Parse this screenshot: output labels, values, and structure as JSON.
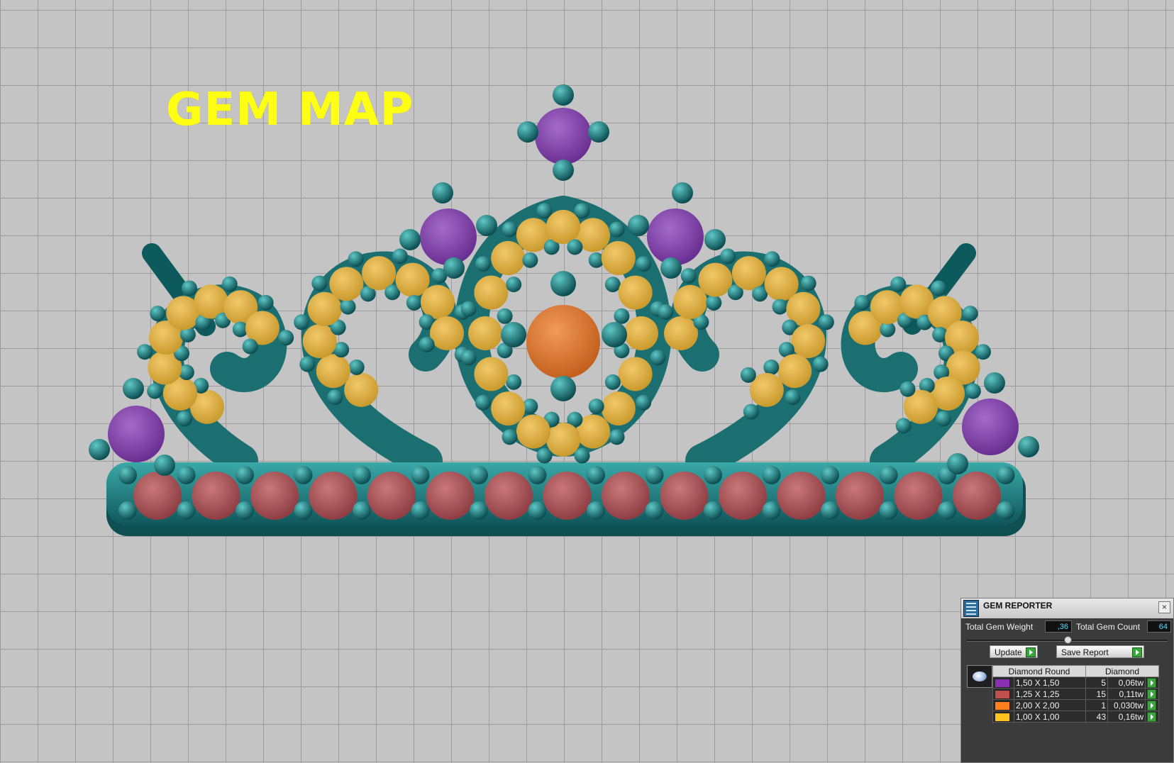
{
  "viewport": {
    "title_text": "GEM MAP",
    "model": "crown-tiara",
    "colors": {
      "metal": "#1f7f80",
      "grid_bg": "#c4c4c4",
      "title": "#ffff14"
    }
  },
  "panel": {
    "title": "GEM REPORTER",
    "close_label": "×",
    "total_weight_label": "Total Gem Weight",
    "total_weight_value": ",36",
    "total_count_label": "Total Gem Count",
    "total_count_value": "64",
    "update_label": "Update",
    "save_label": "Save Report",
    "table": {
      "headers": [
        "Diamond Round",
        "Diamond"
      ],
      "rows": [
        {
          "swatch": "#8a2fb3",
          "size": "1,50 X 1,50",
          "count": "5",
          "weight": "0,06tw"
        },
        {
          "swatch": "#c0504d",
          "size": "1,25 X 1,25",
          "count": "15",
          "weight": "0,11tw"
        },
        {
          "swatch": "#ff7f1f",
          "size": "2,00 X 2,00",
          "count": "1",
          "weight": "0,030tw"
        },
        {
          "swatch": "#ffc21f",
          "size": "1,00 X 1,00",
          "count": "43",
          "weight": "0,16tw"
        }
      ]
    }
  }
}
